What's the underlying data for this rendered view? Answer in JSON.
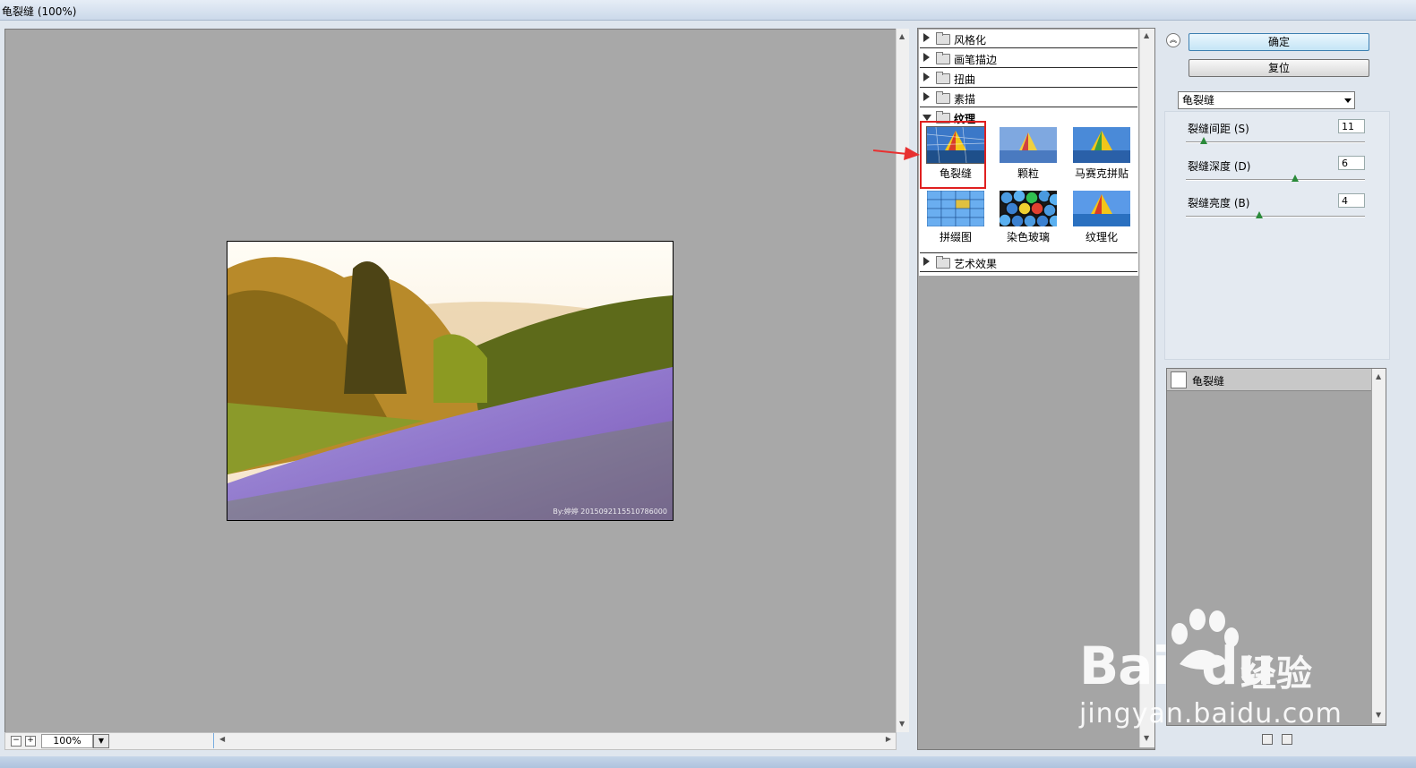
{
  "window": {
    "title": "龟裂缝 (100%)"
  },
  "preview": {
    "zoom": "100%",
    "photo_credit": "By:婷婷 2015092115510786000"
  },
  "gallery": {
    "categories": [
      {
        "label": "风格化"
      },
      {
        "label": "画笔描边"
      },
      {
        "label": "扭曲"
      },
      {
        "label": "素描"
      },
      {
        "label": "纹理"
      },
      {
        "label": "艺术效果"
      }
    ],
    "texture_filters": [
      {
        "label": "龟裂缝",
        "selected": true
      },
      {
        "label": "颗粒"
      },
      {
        "label": "马赛克拼贴"
      },
      {
        "label": "拼缀图"
      },
      {
        "label": "染色玻璃"
      },
      {
        "label": "纹理化"
      }
    ]
  },
  "controls": {
    "ok_label": "确定",
    "reset_label": "复位",
    "filter_select": "龟裂缝",
    "params": [
      {
        "label": "裂缝间距 (S)",
        "value": "11",
        "fraction": 0.1
      },
      {
        "label": "裂缝深度 (D)",
        "value": "6",
        "fraction": 0.6
      },
      {
        "label": "裂缝亮度 (B)",
        "value": "4",
        "fraction": 0.4
      }
    ]
  },
  "layers": {
    "items": [
      {
        "label": "龟裂缝"
      }
    ]
  },
  "watermark": {
    "brand": "Bai",
    "brand2": "du",
    "cn": "经验",
    "url": "jingyan.baidu.com"
  },
  "colors": {
    "selection": "#e02020",
    "primary_button": "#c4e5f6",
    "slider_thumb": "#2a8a3a"
  }
}
